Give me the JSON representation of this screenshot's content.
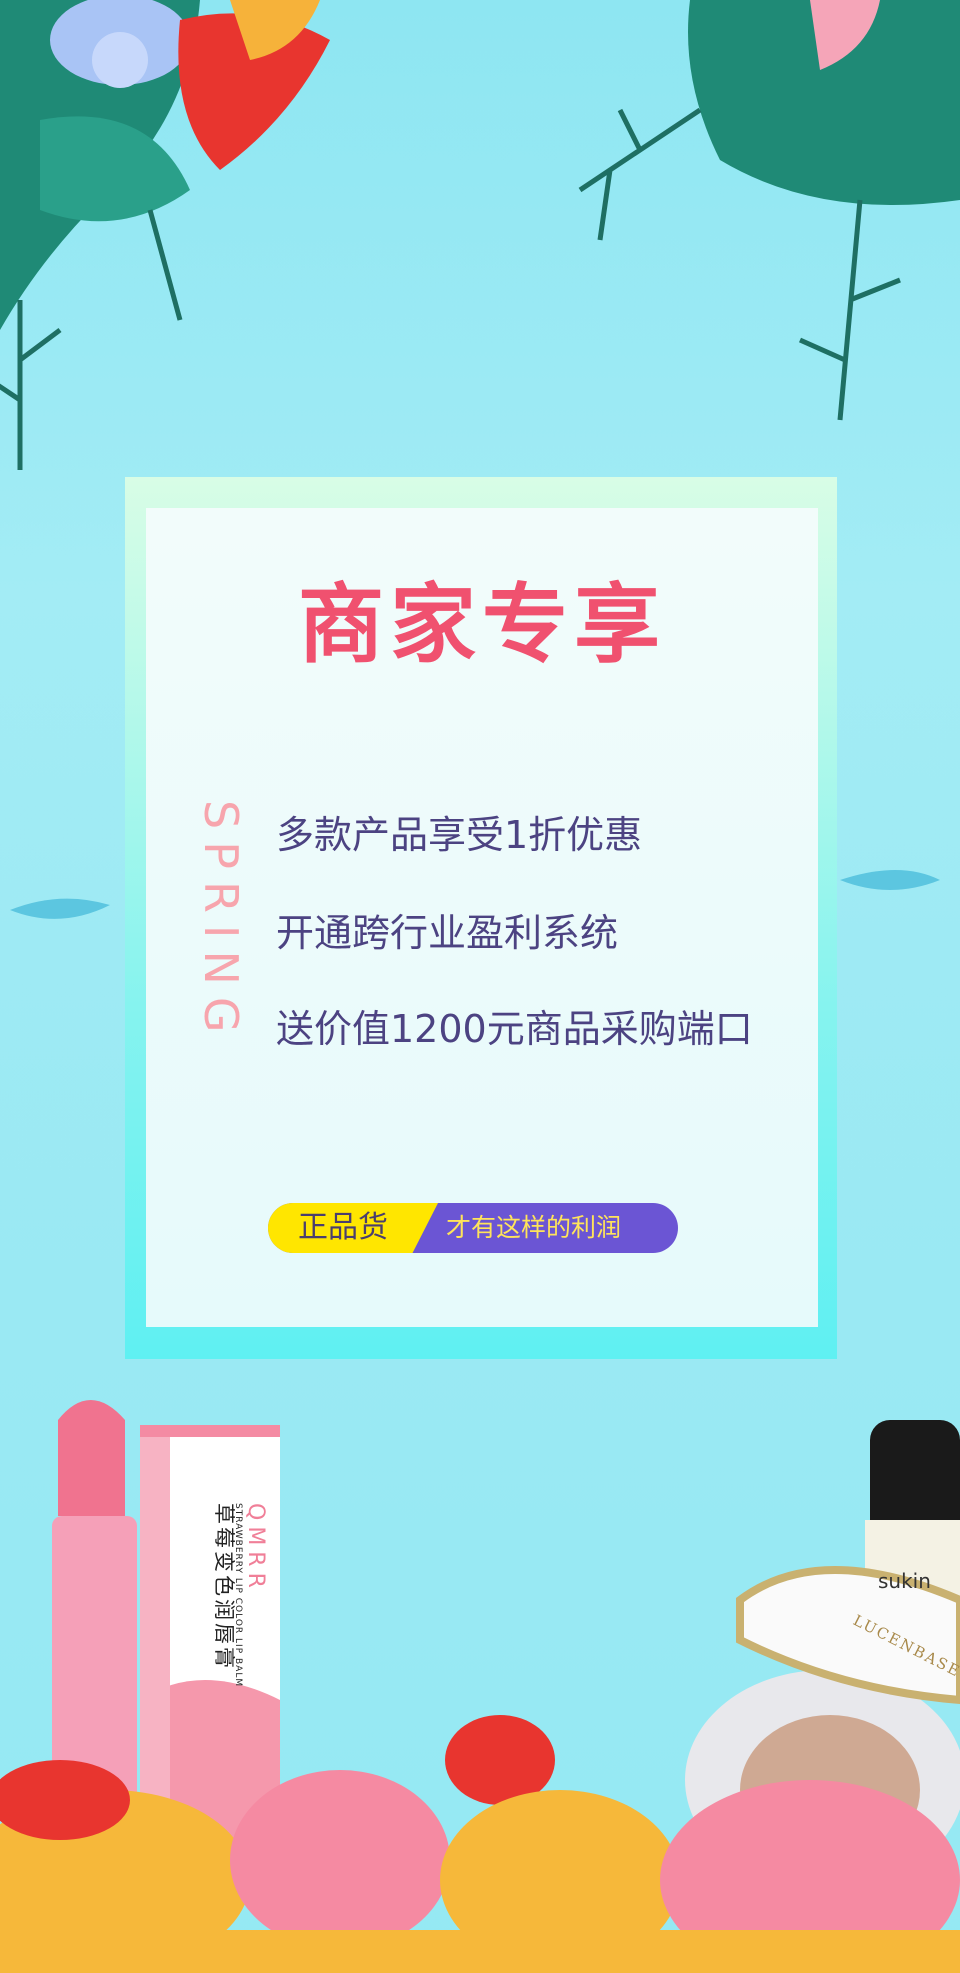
{
  "card": {
    "title": "商家专享",
    "side_text": "SPRING",
    "benefits": [
      "多款产品享受1折优惠",
      "开通跨行业盈利系统",
      "送价值1200元商品采购端口"
    ],
    "badge": {
      "left": "正品货",
      "right": "才有这样的利润"
    }
  },
  "products": {
    "lip_balm_brand": "QMRR",
    "lip_balm_name": "草莓变色润唇膏",
    "lip_balm_subtitle": "STRAWBERRY LIP COLOR LIP BALM",
    "bottle_brand": "sukin",
    "cushion_brand": "LUCENBASE"
  },
  "colors": {
    "title": "#f0516f",
    "text": "#4c4382",
    "badge_yellow": "#ffe600",
    "badge_purple": "#6b55d4",
    "spring": "#f7a5ad"
  }
}
